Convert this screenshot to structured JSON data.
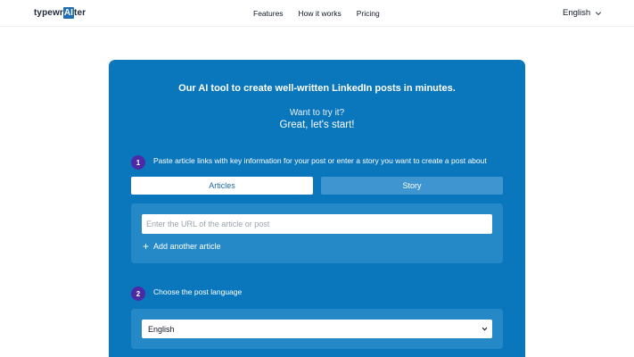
{
  "header": {
    "logo": {
      "pre": "typewr",
      "ai": "AI",
      "post": "ter"
    },
    "nav": [
      {
        "label": "Features"
      },
      {
        "label": "How it works"
      },
      {
        "label": "Pricing"
      }
    ],
    "language": "English",
    "language_icon": "chevron-down-icon"
  },
  "card": {
    "headline": "Our AI tool to create well-written LinkedIn posts in minutes.",
    "want": "Want to try it?",
    "great": "Great, let's start!",
    "step1": {
      "number": "1",
      "text": "Paste article links with key information for your post or enter a story you want to create a post about"
    },
    "tabs": [
      {
        "label": "Articles",
        "active": true
      },
      {
        "label": "Story",
        "active": false
      }
    ],
    "url_placeholder": "Enter the URL of the article or post",
    "add_article": "Add another article",
    "add_icon": "plus-icon",
    "step2": {
      "number": "2",
      "text": "Choose the post language"
    },
    "post_language": "English"
  },
  "colors": {
    "card_bg": "#0a77bd",
    "step_badge": "#4c2aa7",
    "logo_ai_bg": "#1f6fb5"
  }
}
